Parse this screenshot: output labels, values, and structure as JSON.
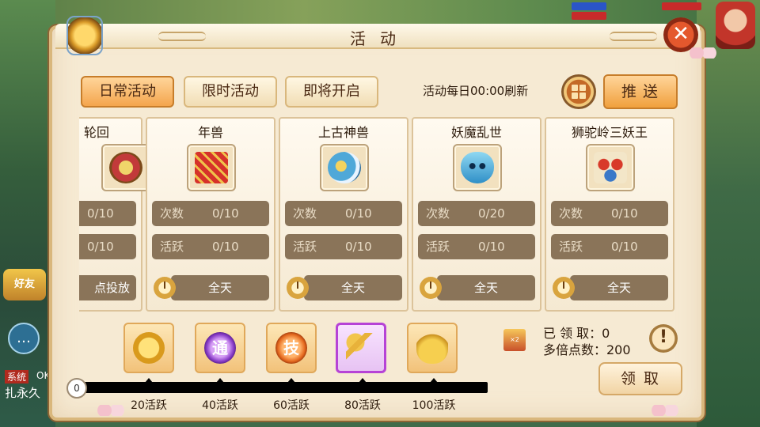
{
  "window": {
    "title": "活动"
  },
  "tabs": [
    {
      "label": "日常活动",
      "active": true
    },
    {
      "label": "限时活动",
      "active": false
    },
    {
      "label": "即将开启",
      "active": false
    }
  ],
  "refresh_text": "活动每日00:00刷新",
  "push_button": "推送",
  "activities": [
    {
      "name": "轮回",
      "count_label": "次数",
      "count": "0/10",
      "active_label": "活跃",
      "active": "0/10",
      "time": "点投放",
      "icon": "tower-icon"
    },
    {
      "name": "年兽",
      "count_label": "次数",
      "count": "0/10",
      "active_label": "活跃",
      "active": "0/10",
      "time": "全天",
      "icon": "firecracker-icon"
    },
    {
      "name": "上古神兽",
      "count_label": "次数",
      "count": "0/10",
      "active_label": "活跃",
      "active": "0/10",
      "time": "全天",
      "icon": "beast-icon"
    },
    {
      "name": "妖魔乱世",
      "count_label": "次数",
      "count": "0/20",
      "active_label": "活跃",
      "active": "0/10",
      "time": "全天",
      "icon": "mask-icon"
    },
    {
      "name": "狮驼岭三妖王",
      "count_label": "次数",
      "count": "0/10",
      "active_label": "活跃",
      "active": "0/10",
      "time": "全天",
      "icon": "demon-kings-icon"
    }
  ],
  "rewards": [
    {
      "label": "20活跃",
      "icon": "gold-coin-icon",
      "glyph": ""
    },
    {
      "label": "40活跃",
      "icon": "purple-token-icon",
      "glyph": "通"
    },
    {
      "label": "60活跃",
      "icon": "skill-orb-icon",
      "glyph": "技"
    },
    {
      "label": "80活跃",
      "icon": "gold-key-icon",
      "glyph": ""
    },
    {
      "label": "100活跃",
      "icon": "treasure-bag-icon",
      "glyph": ""
    }
  ],
  "progress": {
    "start_value": "0",
    "fraction": 0
  },
  "claim": {
    "claimed_line": "已 领 取：0",
    "multiplier_line": "多倍点数：200",
    "info_glyph": "!",
    "button": "领取"
  },
  "side": {
    "friend_badge": "好友",
    "tag": "系统",
    "ok": "OK",
    "text": "扎永久"
  },
  "colors": {
    "panel_bg": "#f6ead3",
    "accent_orange": "#f4a54d",
    "stat_bar": "#8a7459",
    "highlight_purple": "#b643d6"
  }
}
